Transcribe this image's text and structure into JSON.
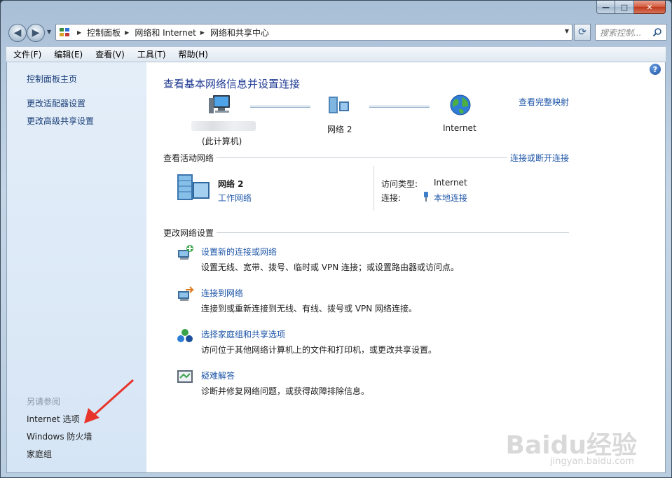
{
  "window": {
    "caption": {
      "minimize": "—",
      "maximize": "□",
      "close": "✕"
    }
  },
  "address": {
    "crumbs": [
      "控制面板",
      "网络和 Internet",
      "网络和共享中心"
    ],
    "search_placeholder": "搜索控制..."
  },
  "menu": [
    "文件(F)",
    "编辑(E)",
    "查看(V)",
    "工具(T)",
    "帮助(H)"
  ],
  "sidebar": {
    "items": [
      "控制面板主页",
      "更改适配器设置",
      "更改高级共享设置"
    ],
    "see_also_label": "另请参阅",
    "see_also": [
      "Internet 选项",
      "Windows 防火墙",
      "家庭组"
    ]
  },
  "main": {
    "title": "查看基本网络信息并设置连接",
    "view_full_map": "查看完整映射",
    "map": {
      "computer_label": "(此计算机)",
      "network_label": "网络  2",
      "internet_label": "Internet"
    },
    "active_networks": {
      "heading": "查看活动网络",
      "connect_link": "连接或断开连接",
      "network_name": "网络  2",
      "network_type": "工作网络",
      "access_type_label": "访问类型:",
      "access_type_value": "Internet",
      "connections_label": "连接:",
      "connections_value": "本地连接"
    },
    "change_settings": {
      "heading": "更改网络设置",
      "tasks": [
        {
          "title": "设置新的连接或网络",
          "desc": "设置无线、宽带、拨号、临时或 VPN 连接；或设置路由器或访问点。"
        },
        {
          "title": "连接到网络",
          "desc": "连接到或重新连接到无线、有线、拨号或 VPN 网络连接。"
        },
        {
          "title": "选择家庭组和共享选项",
          "desc": "访问位于其他网络计算机上的文件和打印机，或更改共享设置。"
        },
        {
          "title": "疑难解答",
          "desc": "诊断并修复网络问题，或获得故障排除信息。"
        }
      ]
    }
  },
  "watermark": {
    "brand": "Baidu经验",
    "url": "jingyan.baidu.com"
  },
  "colors": {
    "link": "#1f57a8",
    "title": "#1f3a93",
    "annotation_arrow": "#e8352b"
  }
}
